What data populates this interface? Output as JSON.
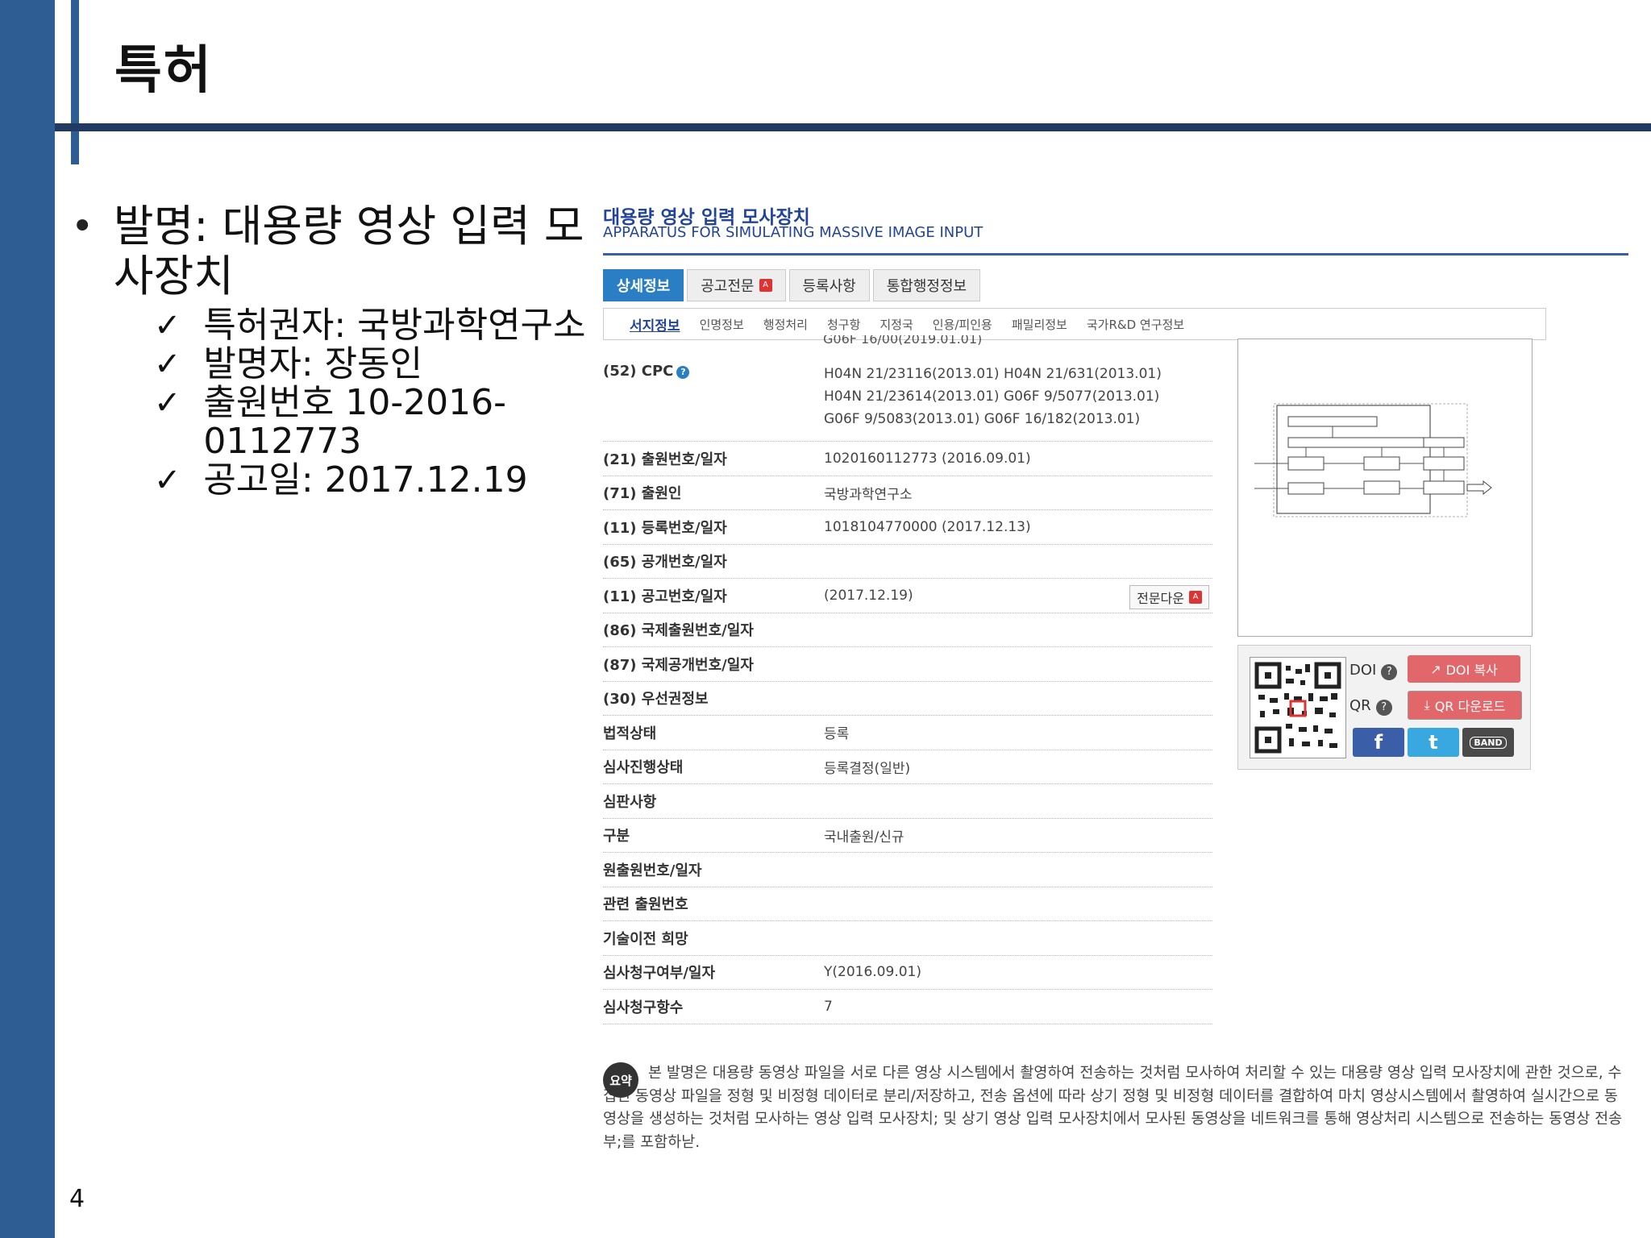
{
  "slide": {
    "title": "특허",
    "page_number": "4",
    "bullets": {
      "dot": "•",
      "main": "발명: 대용량 영상 입력 모사장치",
      "check": "✓",
      "items": [
        "특허권자: 국방과학연구소",
        "발명자: 장동인",
        "출원번호 10-2016-0112773",
        "공고일: 2017.12.19"
      ]
    }
  },
  "patent": {
    "title_ko": "대용량 영상 입력 모사장치",
    "title_en": "APPARATUS FOR SIMULATING MASSIVE IMAGE INPUT",
    "tabs": [
      "상세정보",
      "공고전문",
      "등록사항",
      "통합행정정보"
    ],
    "subtabs": [
      "서지정보",
      "인명정보",
      "행정처리",
      "청구항",
      "지정국",
      "인용/피인용",
      "패밀리정보",
      "국가R&D 연구정보"
    ],
    "cut_row": "G06F 16/00(2019.01.01)",
    "cpc_label": "(52) CPC",
    "cpc_help": "?",
    "cpc_lines": [
      "H04N 21/23116(2013.01) H04N 21/631(2013.01)",
      "H04N 21/23614(2013.01) G06F 9/5077(2013.01)",
      "G06F 9/5083(2013.01) G06F 16/182(2013.01)"
    ],
    "rows": [
      {
        "label": "(21) 출원번호/일자",
        "value": "1020160112773 (2016.09.01)"
      },
      {
        "label": "(71) 출원인",
        "value": "국방과학연구소"
      },
      {
        "label": "(11) 등록번호/일자",
        "value": "1018104770000 (2017.12.13)"
      },
      {
        "label": "(65) 공개번호/일자",
        "value": ""
      },
      {
        "label": "(11) 공고번호/일자",
        "value": "(2017.12.19)"
      },
      {
        "label": "(86) 국제출원번호/일자",
        "value": ""
      },
      {
        "label": "(87) 국제공개번호/일자",
        "value": ""
      },
      {
        "label": "(30) 우선권정보",
        "value": ""
      },
      {
        "label": "법적상태",
        "value": "등록"
      },
      {
        "label": "심사진행상태",
        "value": "등록결정(일반)"
      },
      {
        "label": "심판사항",
        "value": ""
      },
      {
        "label": "구분",
        "value": "국내출원/신규"
      },
      {
        "label": "원출원번호/일자",
        "value": ""
      },
      {
        "label": "관련 출원번호",
        "value": ""
      },
      {
        "label": "기술이전 희망",
        "value": ""
      },
      {
        "label": "심사청구여부/일자",
        "value": "Y(2016.09.01)"
      },
      {
        "label": "심사청구항수",
        "value": "7"
      }
    ],
    "download_label": "전문다운",
    "doi_label": "DOI",
    "qr_label": "QR",
    "help_q": "?",
    "doi_copy": "DOI 복사",
    "qr_download": "QR 다운로드",
    "social": {
      "facebook": "f",
      "twitter": "t",
      "band": "BAND"
    },
    "abstract_badge": "요약",
    "abstract": "본 발명은 대용량 동영상 파일을 서로 다른 영상 시스템에서 촬영하여 전송하는 것처럼 모사하여 처리할 수 있는 대용량 영상 입력 모사장치에 관한 것으로, 수집된 동영상 파일을 정형 및 비정형 데이터로 분리/저장하고, 전송 옵션에 따라 상기 정형 및 비정형 데이터를 결합하여 마치 영상시스템에서 촬영하여 실시간으로 동영상을 생성하는 것처럼 모사하는 영상 입력 모사장치; 및 상기 영상 입력 모사장치에서 모사된 동영상을 네트워크를 통해 영상처리 시스템으로 전송하는 동영상 전송부;를 포함하낟.",
    "colors": {
      "accent_blue": "#2a7fc4",
      "title_blue": "#22449a",
      "slide_band": "#2e5d93",
      "pink": "#e2676b"
    }
  }
}
